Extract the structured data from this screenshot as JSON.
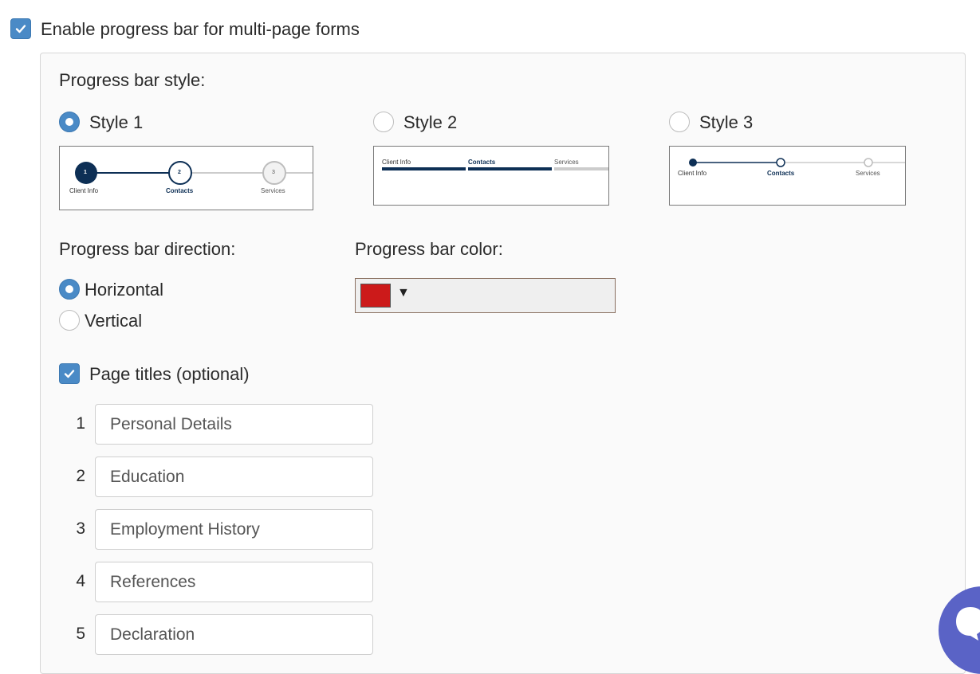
{
  "enable": {
    "label": "Enable progress bar for multi-page forms",
    "checked": true
  },
  "style_section": {
    "title": "Progress bar style:",
    "selected": "Style 1",
    "options": [
      {
        "label": "Style 1",
        "preview_steps": [
          {
            "num": "1",
            "label": "Client Info"
          },
          {
            "num": "2",
            "label": "Contacts"
          },
          {
            "num": "3",
            "label": "Services"
          }
        ]
      },
      {
        "label": "Style 2",
        "preview_steps": [
          {
            "label": "Client Info"
          },
          {
            "label": "Contacts"
          },
          {
            "label": "Services"
          }
        ]
      },
      {
        "label": "Style 3",
        "preview_steps": [
          {
            "label": "Client Info"
          },
          {
            "label": "Contacts"
          },
          {
            "label": "Services"
          }
        ]
      }
    ]
  },
  "direction": {
    "title": "Progress bar direction:",
    "selected": "Horizontal",
    "options": [
      "Horizontal",
      "Vertical"
    ]
  },
  "color": {
    "title": "Progress bar color:",
    "value": "#cc1a1a",
    "arrow": "▼"
  },
  "page_titles": {
    "label": "Page titles (optional)",
    "checked": true,
    "rows": [
      {
        "num": "1",
        "value": "Personal Details"
      },
      {
        "num": "2",
        "value": "Education"
      },
      {
        "num": "3",
        "value": "Employment History"
      },
      {
        "num": "4",
        "value": "References"
      },
      {
        "num": "5",
        "value": "Declaration"
      }
    ]
  },
  "colors": {
    "accent": "#4a8ac6",
    "navy": "#0d2f55",
    "chat": "#5a63c6"
  },
  "icons": [
    "check-icon",
    "chevron-down-icon",
    "chat-icon"
  ]
}
